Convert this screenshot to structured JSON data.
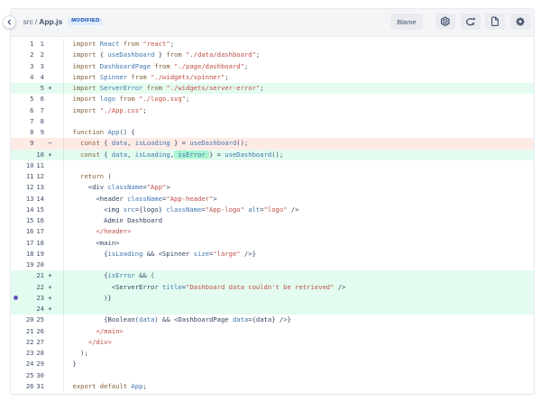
{
  "header": {
    "breadcrumb": {
      "folder": "src",
      "separator": "/",
      "file": "App.js"
    },
    "badge": "MODIFIED",
    "blame_label": "Blame",
    "icons": [
      "diff-view-settings-icon",
      "refresh-icon",
      "file-contents-icon",
      "settings-icon"
    ]
  },
  "colors": {
    "header_bg": "#f4f5f7",
    "button_bg": "#ebecf0",
    "icon_color": "#42526e",
    "badge_bg": "#deebff",
    "badge_text": "#0747a6",
    "added_row_bg": "#e3fcef",
    "removed_row_bg": "#ffebe6",
    "word_highlight_bg": "#abf5d1",
    "keyword": "#85613b",
    "identifier": "#4077b2",
    "string": "#bf4e44",
    "closing_tag": "#bf4e44",
    "plain_code": "#344563",
    "line_number": "#42526e",
    "comment_dot": "#6554c0"
  },
  "diff": {
    "rows": [
      {
        "o": "1",
        "n": "1",
        "t": "ctx",
        "tok": [
          [
            "k",
            "import "
          ],
          [
            "v",
            "React "
          ],
          [
            "k",
            "from "
          ],
          [
            "s",
            "\"react\""
          ],
          [
            "t",
            ";"
          ]
        ]
      },
      {
        "o": "2",
        "n": "2",
        "t": "ctx",
        "tok": [
          [
            "k",
            "import "
          ],
          [
            "t",
            "{ "
          ],
          [
            "v",
            "useDashboard"
          ],
          [
            "t",
            " } "
          ],
          [
            "k",
            "from "
          ],
          [
            "s",
            "\"./data/dashboard\""
          ],
          [
            "t",
            ";"
          ]
        ]
      },
      {
        "o": "3",
        "n": "3",
        "t": "ctx",
        "tok": [
          [
            "k",
            "import "
          ],
          [
            "v",
            "DashboardPage "
          ],
          [
            "k",
            "from "
          ],
          [
            "s",
            "\"./page/dashboard\""
          ],
          [
            "t",
            ";"
          ]
        ]
      },
      {
        "o": "4",
        "n": "4",
        "t": "ctx",
        "tok": [
          [
            "k",
            "import "
          ],
          [
            "v",
            "Spinner "
          ],
          [
            "k",
            "from "
          ],
          [
            "s",
            "\"./widgets/spinner\""
          ],
          [
            "t",
            ";"
          ]
        ]
      },
      {
        "o": "",
        "n": "5",
        "t": "add",
        "sign": "+",
        "tok": [
          [
            "k",
            "import "
          ],
          [
            "v",
            "ServerError "
          ],
          [
            "k",
            "from "
          ],
          [
            "s",
            "\"./widgets/server-error\""
          ],
          [
            "t",
            ";"
          ]
        ]
      },
      {
        "o": "5",
        "n": "6",
        "t": "ctx",
        "tok": [
          [
            "k",
            "import "
          ],
          [
            "v",
            "logo "
          ],
          [
            "k",
            "from "
          ],
          [
            "s",
            "\"./logo.svg\""
          ],
          [
            "t",
            ";"
          ]
        ]
      },
      {
        "o": "6",
        "n": "7",
        "t": "ctx",
        "tok": [
          [
            "k",
            "import "
          ],
          [
            "s",
            "\"./App.css\""
          ],
          [
            "t",
            ";"
          ]
        ]
      },
      {
        "o": "7",
        "n": "8",
        "t": "ctx",
        "tok": []
      },
      {
        "o": "8",
        "n": "9",
        "t": "ctx",
        "tok": [
          [
            "k",
            "function "
          ],
          [
            "v",
            "App"
          ],
          [
            "t",
            "() {"
          ]
        ]
      },
      {
        "o": "9",
        "n": "",
        "t": "del",
        "sign": "−",
        "tok": [
          [
            "t",
            "  "
          ],
          [
            "k",
            "const "
          ],
          [
            "t",
            "{ "
          ],
          [
            "v",
            "data"
          ],
          [
            "t",
            ", "
          ],
          [
            "v",
            "isLoading"
          ],
          [
            "t",
            " } = "
          ],
          [
            "v",
            "useDashboard"
          ],
          [
            "t",
            "();"
          ]
        ]
      },
      {
        "o": "",
        "n": "10",
        "t": "add",
        "sign": "+",
        "tok": [
          [
            "t",
            "  "
          ],
          [
            "k",
            "const "
          ],
          [
            "t",
            "{ "
          ],
          [
            "v",
            "data"
          ],
          [
            "t",
            ", "
          ],
          [
            "v",
            "isLoading"
          ],
          [
            "t",
            ","
          ],
          [
            "h",
            [
              [
                "t",
                " "
              ],
              [
                "v",
                "isError"
              ],
              [
                "t",
                " "
              ]
            ]
          ],
          [
            "t",
            "} = "
          ],
          [
            "v",
            "useDashboard"
          ],
          [
            "t",
            "();"
          ]
        ]
      },
      {
        "o": "10",
        "n": "11",
        "t": "ctx",
        "tok": []
      },
      {
        "o": "11",
        "n": "12",
        "t": "ctx",
        "tok": [
          [
            "t",
            "  "
          ],
          [
            "k",
            "return"
          ],
          [
            "t",
            " ("
          ]
        ]
      },
      {
        "o": "12",
        "n": "13",
        "t": "ctx",
        "tok": [
          [
            "t",
            "    <div "
          ],
          [
            "v",
            "className"
          ],
          [
            "t",
            "="
          ],
          [
            "s",
            "\"App\""
          ],
          [
            "t",
            ">"
          ]
        ]
      },
      {
        "o": "13",
        "n": "14",
        "t": "ctx",
        "tok": [
          [
            "t",
            "      <header "
          ],
          [
            "v",
            "className"
          ],
          [
            "t",
            "="
          ],
          [
            "s",
            "\"App-header\""
          ],
          [
            "t",
            ">"
          ]
        ]
      },
      {
        "o": "14",
        "n": "15",
        "t": "ctx",
        "tok": [
          [
            "t",
            "        <img "
          ],
          [
            "v",
            "src"
          ],
          [
            "t",
            "={logo} "
          ],
          [
            "v",
            "className"
          ],
          [
            "t",
            "="
          ],
          [
            "s",
            "\"App-logo\""
          ],
          [
            "t",
            " "
          ],
          [
            "v",
            "alt"
          ],
          [
            "t",
            "="
          ],
          [
            "s",
            "\"logo\""
          ],
          [
            "t",
            " />"
          ]
        ]
      },
      {
        "o": "15",
        "n": "16",
        "t": "ctx",
        "tok": [
          [
            "t",
            "        Admin Dashboard"
          ]
        ]
      },
      {
        "o": "16",
        "n": "17",
        "t": "ctx",
        "tok": [
          [
            "t",
            "      "
          ],
          [
            "r",
            "</header>"
          ]
        ]
      },
      {
        "o": "17",
        "n": "18",
        "t": "ctx",
        "tok": [
          [
            "t",
            "      <main>"
          ]
        ]
      },
      {
        "o": "18",
        "n": "19",
        "t": "ctx",
        "tok": [
          [
            "t",
            "        {"
          ],
          [
            "v",
            "isLoading"
          ],
          [
            "t",
            " && <Spinner "
          ],
          [
            "v",
            "size"
          ],
          [
            "t",
            "="
          ],
          [
            "s",
            "\"large\""
          ],
          [
            "t",
            " />}"
          ]
        ]
      },
      {
        "o": "19",
        "n": "20",
        "t": "ctx",
        "tok": []
      },
      {
        "o": "",
        "n": "21",
        "t": "add",
        "sign": "+",
        "tok": [
          [
            "t",
            "        {"
          ],
          [
            "v",
            "isError"
          ],
          [
            "t",
            " && ("
          ]
        ]
      },
      {
        "o": "",
        "n": "22",
        "t": "add",
        "sign": "+",
        "tok": [
          [
            "t",
            "          <ServerError "
          ],
          [
            "v",
            "title"
          ],
          [
            "t",
            "="
          ],
          [
            "s",
            "\"Dashboard data couldn't be retrieved\""
          ],
          [
            "t",
            " />"
          ]
        ]
      },
      {
        "o": "",
        "n": "23",
        "t": "add",
        "sign": "+",
        "dot": true,
        "tok": [
          [
            "t",
            "        )}"
          ]
        ]
      },
      {
        "o": "",
        "n": "24",
        "t": "add",
        "sign": "+",
        "tok": []
      },
      {
        "o": "20",
        "n": "25",
        "t": "ctx",
        "tok": [
          [
            "t",
            "        {Boolean("
          ],
          [
            "v",
            "data"
          ],
          [
            "t",
            ") && <DashboardPage "
          ],
          [
            "v",
            "data"
          ],
          [
            "t",
            "={data} />}"
          ]
        ]
      },
      {
        "o": "21",
        "n": "26",
        "t": "ctx",
        "tok": [
          [
            "t",
            "      "
          ],
          [
            "r",
            "</main>"
          ]
        ]
      },
      {
        "o": "22",
        "n": "27",
        "t": "ctx",
        "tok": [
          [
            "t",
            "    "
          ],
          [
            "r",
            "</div>"
          ]
        ]
      },
      {
        "o": "23",
        "n": "28",
        "t": "ctx",
        "tok": [
          [
            "t",
            "  );"
          ]
        ]
      },
      {
        "o": "24",
        "n": "29",
        "t": "ctx",
        "tok": [
          [
            "t",
            "}"
          ]
        ]
      },
      {
        "o": "25",
        "n": "30",
        "t": "ctx",
        "tok": []
      },
      {
        "o": "26",
        "n": "31",
        "t": "ctx",
        "tok": [
          [
            "k",
            "export default "
          ],
          [
            "v",
            "App"
          ],
          [
            "t",
            ";"
          ]
        ]
      }
    ]
  }
}
